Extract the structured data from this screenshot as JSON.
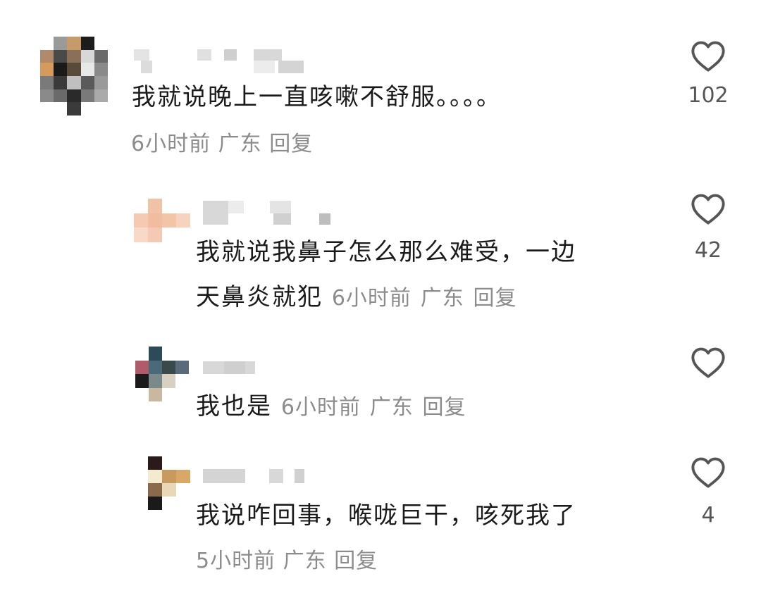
{
  "comments": [
    {
      "text": "我就说晚上一直咳嗽不舒服。。。。",
      "time": "6小时前",
      "location": "广东",
      "reply_label": "回复",
      "likes": "102"
    },
    {
      "text_line1": "我就说我鼻子怎么那么难受，一边",
      "text_line2": "天鼻炎就犯",
      "time": "6小时前",
      "location": "广东",
      "reply_label": "回复",
      "likes": "42"
    },
    {
      "text": "我也是",
      "time": "6小时前",
      "location": "广东",
      "reply_label": "回复",
      "likes": ""
    },
    {
      "text": "我说咋回事，喉咙巨干，咳死我了",
      "time": "5小时前",
      "location": "广东",
      "reply_label": "回复",
      "likes": "4"
    }
  ],
  "icons": {
    "like": "heart-outline-icon"
  },
  "colors": {
    "text": "#1a1a1a",
    "meta": "#8c8c8c",
    "icon": "#555555"
  }
}
